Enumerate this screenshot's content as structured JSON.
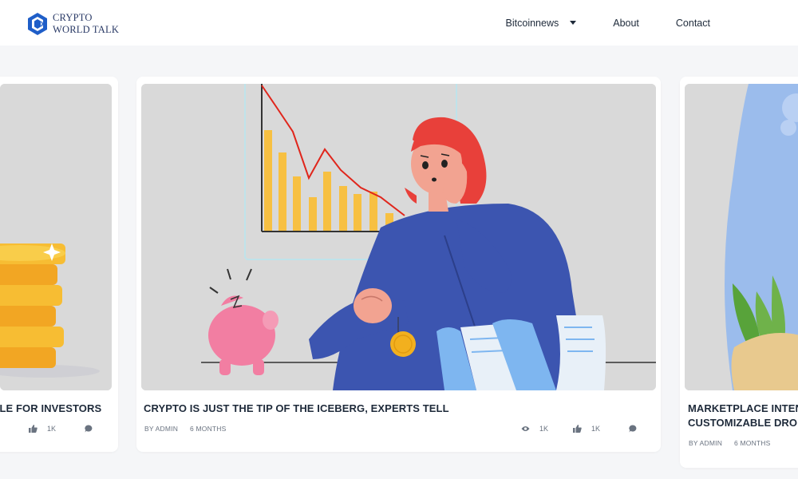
{
  "brand": {
    "line1": "CRYPTO",
    "line2": "WORLD TALK"
  },
  "nav": {
    "items": [
      "Bitcoinnews",
      "About",
      "Contact"
    ]
  },
  "cards": {
    "left": {
      "title": "BLE FOR INVESTORS",
      "likes": "1K"
    },
    "main": {
      "title": "CRYPTO IS JUST THE TIP OF THE ICEBERG, EXPERTS TELL",
      "author": "BY ADMIN",
      "age": "6 MONTHS",
      "views": "1K",
      "likes": "1K"
    },
    "right": {
      "title_line1": "MARKETPLACE INTEND",
      "title_line2": "CUSTOMIZABLE DROP I",
      "author": "BY ADMIN",
      "age": "6 MONTHS"
    }
  },
  "icons": {
    "logo": "hexagon-logo-icon",
    "views": "eye-icon",
    "likes": "thumbs-up-icon",
    "comments": "chat-bubble-icon",
    "dropdown": "chevron-down-icon"
  },
  "colors": {
    "accent": "#1f5ec8",
    "background": "#f5f6f8",
    "illustration_bg": "#d9d9d9",
    "chart_bar": "#f7c042",
    "chart_line": "#e0261c",
    "sweater": "#3c55b0",
    "hair": "#e8403a",
    "piggy": "#f27ea2"
  }
}
